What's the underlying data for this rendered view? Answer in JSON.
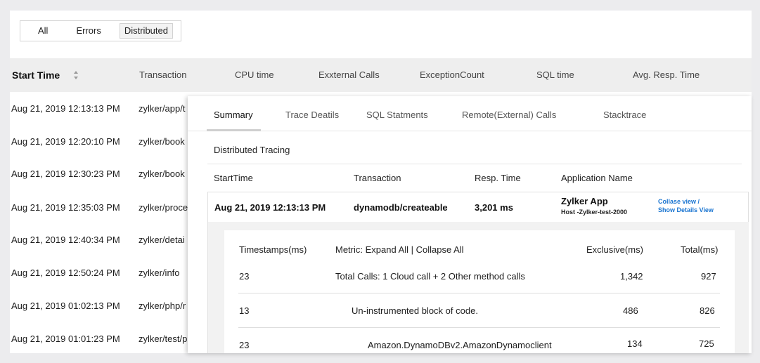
{
  "filters": {
    "all": "All",
    "errors": "Errors",
    "distributed": "Distributed"
  },
  "columns": {
    "start_time": "Start Time",
    "transaction": "Transaction",
    "cpu_time": "CPU time",
    "external_calls": "Exxternal Calls",
    "exception_count": "ExceptionCount",
    "sql_time": "SQL time",
    "avg_resp_time": "Avg. Resp. Time"
  },
  "rows": [
    {
      "time": "Aug 21, 2019 12:13:13 PM",
      "txn": "zylker/app/t"
    },
    {
      "time": "Aug 21, 2019 12:20:10 PM",
      "txn": "zylker/book"
    },
    {
      "time": "Aug 21, 2019 12:30:23 PM",
      "txn": "zylker/book"
    },
    {
      "time": "Aug 21, 2019 12:35:03 PM",
      "txn": "zylker/proce"
    },
    {
      "time": "Aug 21, 2019 12:40:34 PM",
      "txn": "zylker/detai"
    },
    {
      "time": "Aug 21, 2019 12:50:24 PM",
      "txn": "zylker/info"
    },
    {
      "time": "Aug 21, 2019 01:02:13 PM",
      "txn": "zylker/php/r"
    },
    {
      "time": "Aug 21, 2019 01:01:23 PM",
      "txn": "zylker/test/p"
    }
  ],
  "tabs": [
    "Summary",
    "Trace Deatils",
    "SQL Statments",
    "Remote(External) Calls",
    "Stacktrace"
  ],
  "distributed": {
    "title": "Distributed Tracing",
    "headers": {
      "start": "StartTime",
      "txn": "Transaction",
      "resp": "Resp. Time",
      "app": "Application Name"
    },
    "row": {
      "start": "Aug 21, 2019 12:13:13 PM",
      "txn": "dynamodb/createable",
      "resp": "3,201 ms",
      "app": "Zylker App",
      "host": "Host -Zylker-test-2000",
      "link1": "Collase view /",
      "link2": "Show Details View"
    }
  },
  "metrics": {
    "headers": {
      "ts": "Timestamps(ms)",
      "metric": "Metric: Expand All | Collapse All",
      "excl": "Exclusive(ms)",
      "total": "Total(ms)"
    },
    "rows": [
      {
        "ts": "23",
        "metric": "Total Calls: 1 Cloud call + 2 Other method calls",
        "excl": "1,342",
        "total": "927"
      },
      {
        "ts": "13",
        "metric": "Un-instrumented block of code.",
        "excl": "486",
        "total": "826"
      },
      {
        "ts": "23",
        "metric": "Amazon.DynamoDBv2.AmazonDynamoclient",
        "excl": "134",
        "total": "725"
      }
    ]
  },
  "colors": {
    "accent_link": "#1a75d1",
    "page_bg": "#ececee",
    "header_bg": "#eeeeee"
  }
}
